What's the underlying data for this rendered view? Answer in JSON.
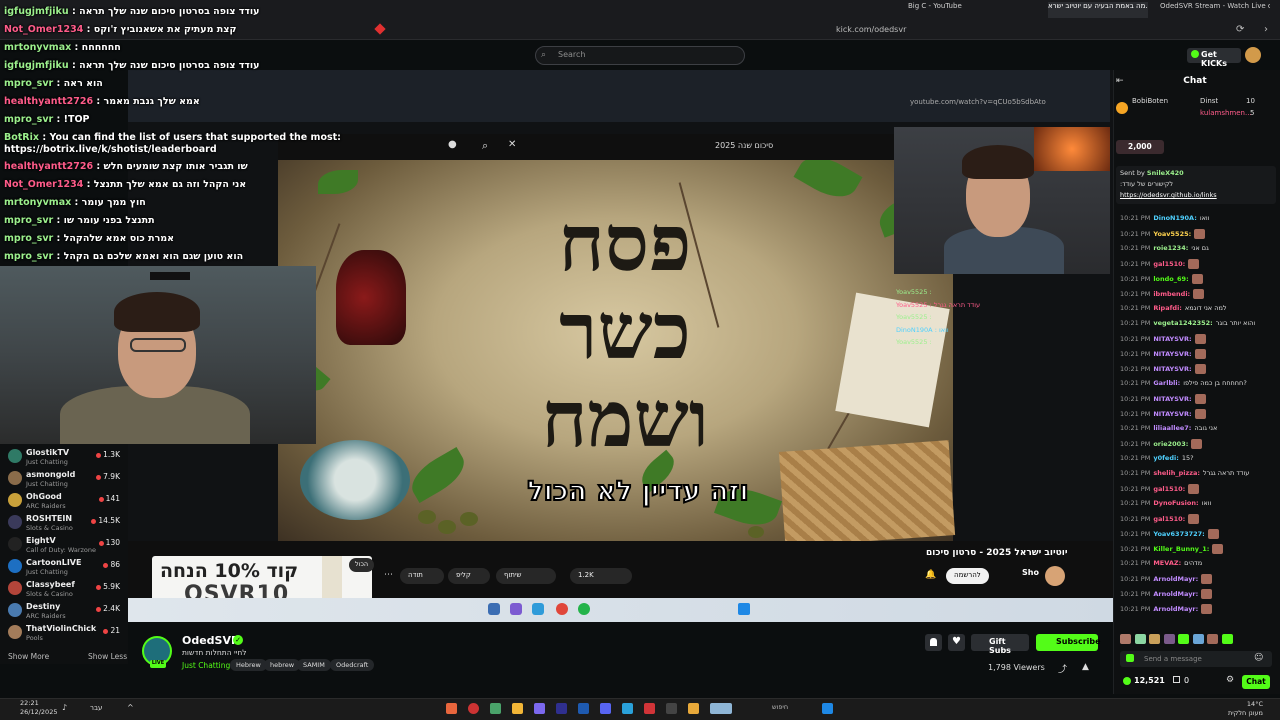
{
  "browser": {
    "tabs": [
      {
        "label": "Big C - YouTube"
      },
      {
        "label": "מה באמת הבעיה עם יוטיוב ישרא..."
      },
      {
        "label": "OdedSVR Stream - Watch Live on"
      }
    ],
    "url": "kick.com/odedsvr"
  },
  "overlay_chat": [
    {
      "user": "igfugjmfjiku",
      "text": "עודד צופה בסרטון סיכום שנה שלך תראה",
      "color": "green"
    },
    {
      "user": "Not_Omer1234",
      "text": "קצת מעתיק את אשאנוביץ ז'וקס",
      "color": "pink"
    },
    {
      "user": "mrtonyvmax",
      "text": "חחחחחח",
      "color": "green"
    },
    {
      "user": "igfugjmfjiku",
      "text": "עודד צופה בסרטון סיכום שנה שלך תראה",
      "color": "green"
    },
    {
      "user": "mpro_svr",
      "text": "הוא ראה",
      "color": "green"
    },
    {
      "user": "healthyantt2726",
      "text": "אמא שלך גנבת מאמר",
      "color": "pink"
    },
    {
      "user": "mpro_svr",
      "text": "!TOP",
      "color": "green"
    },
    {
      "user": "BotRix",
      "text": "You can find the list of users that supported the most:",
      "color": "green"
    },
    {
      "user": "",
      "text": "https://botrix.live/k/shotist/leaderboard",
      "color": "green"
    },
    {
      "user": "healthyantt2726",
      "text": "שו תגביר אותו קצת שומעים חלש",
      "color": "pink"
    },
    {
      "user": "Not_Omer1234",
      "text": "אני הקהל וזה גם אמא שלך תתנצל",
      "color": "pink"
    },
    {
      "user": "mrtonyvmax",
      "text": "חוץ ממך עומר",
      "color": "green"
    },
    {
      "user": "mpro_svr",
      "text": "תתנצל בפני עומר שו",
      "color": "green"
    },
    {
      "user": "mpro_svr",
      "text": "אמרת כוס אמא שלהקהל",
      "color": "green"
    },
    {
      "user": "mpro_svr",
      "text": "הוא טוען שגם הוא ואמא שלכם גם הקהל",
      "color": "green"
    }
  ],
  "header": {
    "search_placeholder": "Search",
    "get_kicks_label": "Get KICKs"
  },
  "video": {
    "title_lines": [
      "פסח",
      "כשר",
      "ושמח"
    ],
    "caption": "וזה עדיין לא הכול",
    "yt_search_text": "סיכום שנה 2025",
    "yt_url": "youtube.com/watch?v=qCUo5bSdbAto",
    "yt_video_title": "יוטיוב ישראל 2025 - סרטון סיכום",
    "yt_channel": "Sho",
    "yt_subscribe": "להרשמה",
    "yt_likes": "1.2K",
    "yt_share": "שיתוף",
    "yt_clip": "קליפ",
    "yt_thanks": "תודה",
    "promo_text": "קוד 10% הנחה",
    "promo_code": "OSVR10",
    "promo_tag": "הכול"
  },
  "follow_list": {
    "items": [
      {
        "name": "GlostikTV",
        "category": "Just Chatting",
        "count": "1.3K"
      },
      {
        "name": "asmongold",
        "category": "Just Chatting",
        "count": "7.9K"
      },
      {
        "name": "OhGood",
        "category": "ARC Raiders",
        "count": "141"
      },
      {
        "name": "ROSHTEIN",
        "category": "Slots & Casino",
        "count": "14.5K"
      },
      {
        "name": "EightV",
        "category": "Call of Duty: Warzone",
        "count": "130"
      },
      {
        "name": "CartoonLIVE",
        "category": "Just Chatting",
        "count": "86"
      },
      {
        "name": "Classybeef",
        "category": "Slots & Casino",
        "count": "5.9K"
      },
      {
        "name": "Destiny",
        "category": "ARC Raiders",
        "count": "2.4K"
      },
      {
        "name": "ThatViolinChick",
        "category": "Pools",
        "count": "21"
      }
    ],
    "show_more": "Show More",
    "show_less": "Show Less"
  },
  "stream": {
    "live_badge": "LIVE",
    "streamer_name": "OdedSVR",
    "title": "לחיי התחלות חדשות",
    "category": "Just Chatting",
    "tags": [
      "Hebrew",
      "hebrew",
      "SAMIM",
      "Odedcraft"
    ],
    "gift_subs_label": "Gift Subs",
    "subscribe_label": "Subscribe",
    "viewers": "1,798 Viewers"
  },
  "chat": {
    "title": "Chat",
    "pinned_users": [
      {
        "name": "BobiBoten",
        "count": "10"
      },
      {
        "name": "Dinst",
        "count": ""
      },
      {
        "name": "kulamshmen...",
        "count": "5"
      }
    ],
    "goal_amount": "2,000",
    "sent_by": "Sent by",
    "sent_by_user": "SnileX420",
    "sent_text": "לקישורים של עודד:",
    "sent_link": "https://odedsvr.github.io/links",
    "messages": [
      {
        "time": "10:21 PM",
        "user": "DinoN190A:",
        "text": "וואו",
        "color": "#4fd1ff"
      },
      {
        "time": "10:21 PM",
        "user": "Yoav5525:",
        "text": "",
        "color": "#ffd34f"
      },
      {
        "time": "10:21 PM",
        "user": "roie1234:",
        "text": "גם אני",
        "color": "#9cf08d"
      },
      {
        "time": "10:21 PM",
        "user": "gal1510:",
        "text": "",
        "color": "#ff5c8a"
      },
      {
        "time": "10:21 PM",
        "user": "londo_69:",
        "text": "",
        "color": "#53fc18"
      },
      {
        "time": "10:21 PM",
        "user": "ibmbendi:",
        "text": "",
        "color": "#ff5c8a"
      },
      {
        "time": "10:21 PM",
        "user": "Ripafdi:",
        "text": "למה אני דוגמא",
        "color": "#ff5c8a"
      },
      {
        "time": "10:21 PM",
        "user": "vegeta1242352:",
        "text": "והוא יותר בוגר",
        "color": "#9cf08d"
      },
      {
        "time": "10:21 PM",
        "user": "NITAYSVR:",
        "text": "",
        "color": "#c18bff"
      },
      {
        "time": "10:21 PM",
        "user": "NITAYSVR:",
        "text": "",
        "color": "#c18bff"
      },
      {
        "time": "10:21 PM",
        "user": "NITAYSVR:",
        "text": "",
        "color": "#c18bff"
      },
      {
        "time": "10:21 PM",
        "user": "Garlbli:",
        "text": "חחחחח בן כמה פילפו?",
        "color": "#c18bff"
      },
      {
        "time": "10:21 PM",
        "user": "NITAYSVR:",
        "text": "",
        "color": "#c18bff"
      },
      {
        "time": "10:21 PM",
        "user": "NITAYSVR:",
        "text": "",
        "color": "#c18bff"
      },
      {
        "time": "10:21 PM",
        "user": "liliaallee7:",
        "text": "אני גובה",
        "color": "#c18bff"
      },
      {
        "time": "10:21 PM",
        "user": "orie2003:",
        "text": "",
        "color": "#9cf08d"
      },
      {
        "time": "10:21 PM",
        "user": "y0fedi:",
        "text": "15?",
        "color": "#4fd1ff"
      },
      {
        "time": "10:21 PM",
        "user": "shelih_pizza:",
        "text": "עודד תראה גגרל",
        "color": "#ff5c8a"
      },
      {
        "time": "10:21 PM",
        "user": "gal1510:",
        "text": "",
        "color": "#ff5c8a"
      },
      {
        "time": "10:21 PM",
        "user": "DynoFusion:",
        "text": "וואו",
        "color": "#ff5c8a"
      },
      {
        "time": "10:21 PM",
        "user": "gal1510:",
        "text": "",
        "color": "#ff5c8a"
      },
      {
        "time": "10:21 PM",
        "user": "Yoav6373727:",
        "text": "",
        "color": "#4fd1ff"
      },
      {
        "time": "10:21 PM",
        "user": "Killer_Bunny_1:",
        "text": "",
        "color": "#53fc18"
      },
      {
        "time": "10:21 PM",
        "user": "MEVAZ:",
        "text": "מדהים",
        "color": "#ff5c8a"
      },
      {
        "time": "10:21 PM",
        "user": "ArnoldMayr:",
        "text": "",
        "color": "#c18bff"
      },
      {
        "time": "10:21 PM",
        "user": "ArnoldMayr:",
        "text": "",
        "color": "#c18bff"
      },
      {
        "time": "10:21 PM",
        "user": "ArnoldMayr:",
        "text": "",
        "color": "#c18bff"
      }
    ],
    "input_placeholder": "Send a message",
    "kicks_count": "12,521",
    "zero_count": "0",
    "chat_button": "Chat"
  },
  "taskbar": {
    "time": "22:21",
    "date": "26/12/2025",
    "lang": "עבר",
    "search_label": "חיפוש",
    "weather_temp": "14°C",
    "weather_desc": "מעונן חלקית"
  }
}
